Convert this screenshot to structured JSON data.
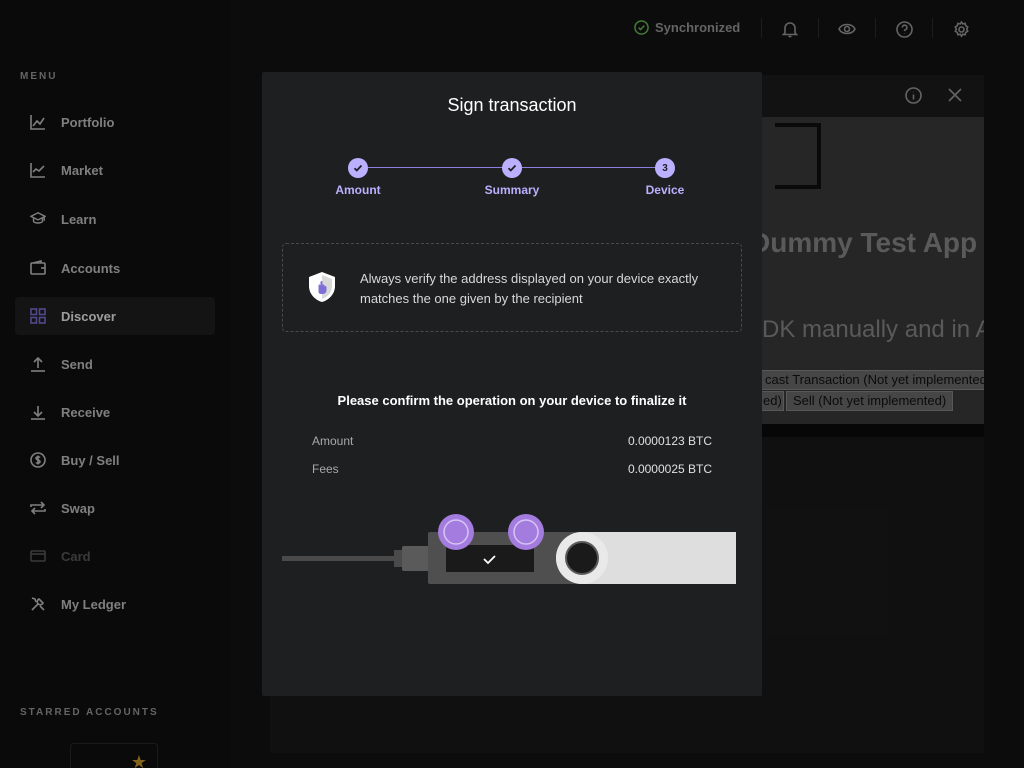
{
  "sidebar": {
    "menu_heading": "MENU",
    "items": [
      {
        "label": "Portfolio",
        "icon": "chart-line-icon"
      },
      {
        "label": "Market",
        "icon": "market-chart-icon"
      },
      {
        "label": "Learn",
        "icon": "graduation-cap-icon"
      },
      {
        "label": "Accounts",
        "icon": "wallet-icon"
      },
      {
        "label": "Discover",
        "icon": "grid-icon",
        "active": true
      },
      {
        "label": "Send",
        "icon": "upload-icon"
      },
      {
        "label": "Receive",
        "icon": "download-icon"
      },
      {
        "label": "Buy / Sell",
        "icon": "dollar-circle-icon"
      },
      {
        "label": "Swap",
        "icon": "swap-arrows-icon"
      },
      {
        "label": "Card",
        "icon": "credit-card-icon",
        "disabled": true
      },
      {
        "label": "My Ledger",
        "icon": "tools-icon"
      }
    ],
    "starred_heading": "STARRED ACCOUNTS"
  },
  "topbar": {
    "sync_status": "Synchronized",
    "icons": [
      "bell-icon",
      "eye-icon",
      "help-icon",
      "settings-icon"
    ]
  },
  "background_app": {
    "title": "Dummy Test App",
    "subtitle": "DK manually and in A",
    "buttons": [
      "cast Transaction (Not yet implemented",
      "ed)",
      "Sell (Not yet implemented)"
    ]
  },
  "modal": {
    "title": "Sign transaction",
    "steps": [
      {
        "label": "Amount",
        "state": "done"
      },
      {
        "label": "Summary",
        "state": "done"
      },
      {
        "label": "Device",
        "state": "current",
        "number": "3"
      }
    ],
    "warning": "Always verify the address displayed on your device exactly matches the one given by the recipient",
    "confirm_message": "Please confirm the operation on your device to finalize it",
    "details": [
      {
        "label": "Amount",
        "value": "0.0000123 BTC"
      },
      {
        "label": "Fees",
        "value": "0.0000025 BTC"
      }
    ]
  },
  "colors": {
    "accent": "#bbb0ff",
    "sync_green": "#66be54",
    "star": "#c99a2e"
  }
}
